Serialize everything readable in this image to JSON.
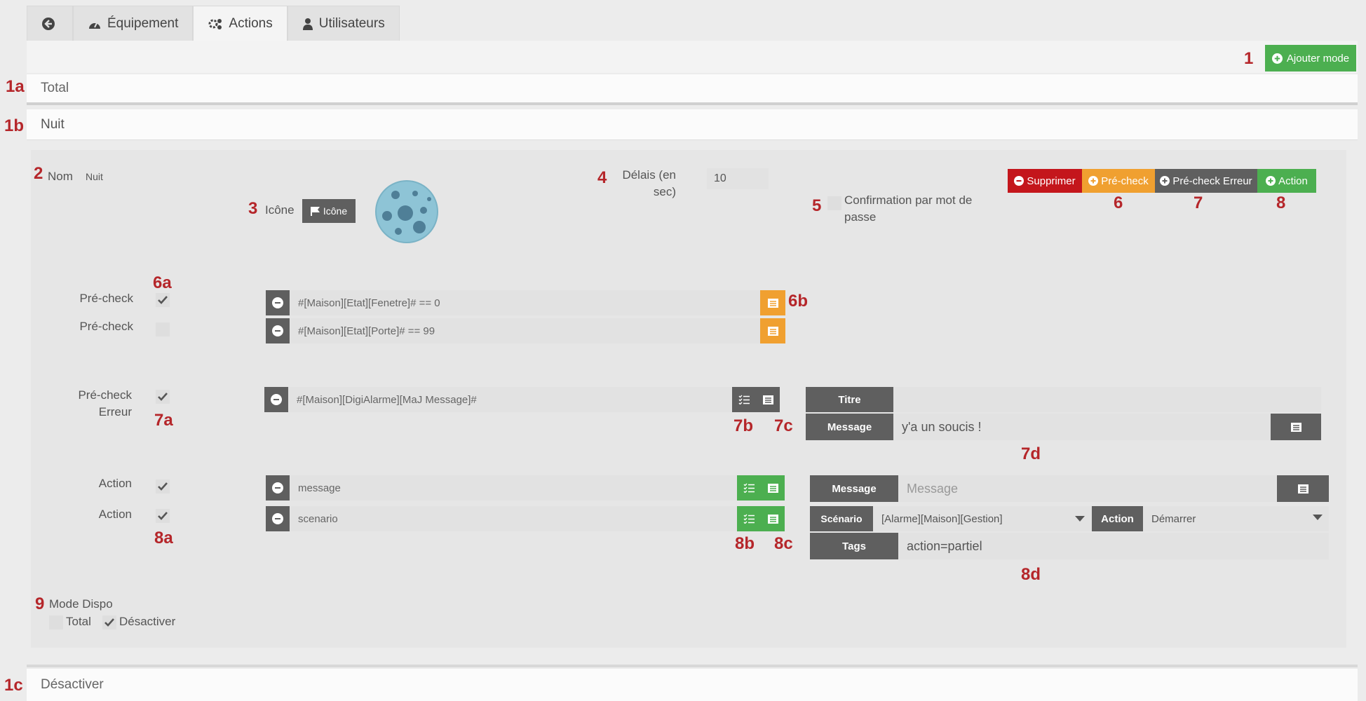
{
  "tabs": [
    {
      "label": "",
      "icon": "back-arrow-icon"
    },
    {
      "label": "Équipement",
      "icon": "dashboard-icon"
    },
    {
      "label": "Actions",
      "icon": "cogs-icon"
    },
    {
      "label": "Utilisateurs",
      "icon": "user-icon"
    }
  ],
  "toolbar": {
    "add_mode_label": "Ajouter mode"
  },
  "markers": {
    "m1": "1",
    "m1a": "1a",
    "m1b": "1b",
    "m1c": "1c",
    "m2": "2",
    "m3": "3",
    "m4": "4",
    "m5": "5",
    "m6": "6",
    "m7": "7",
    "m8": "8",
    "m6a": "6a",
    "m6b": "6b",
    "m7a": "7a",
    "m7b": "7b",
    "m7c": "7c",
    "m7d": "7d",
    "m8a": "8a",
    "m8b": "8b",
    "m8c": "8c",
    "m8d": "8d",
    "m9": "9"
  },
  "panels": {
    "total": "Total",
    "nuit": "Nuit",
    "desactiver": "Désactiver"
  },
  "mode": {
    "name_label": "Nom",
    "name_value": "Nuit",
    "icon_label": "Icône",
    "icon_button": "Icône",
    "delay_label_1": "Délais (en",
    "delay_label_2": "sec)",
    "delay_value": "10",
    "confirm_label_1": "Confirmation par mot de",
    "confirm_label_2": "passe",
    "buttons": {
      "delete": "Supprimer",
      "precheck": "Pré-check",
      "precheck_error": "Pré-check Erreur",
      "action": "Action"
    }
  },
  "prechecks": [
    {
      "label": "Pré-check",
      "checked": true,
      "expression": "#[Maison][Etat][Fenetre]# == 0"
    },
    {
      "label": "Pré-check",
      "checked": false,
      "expression": "#[Maison][Etat][Porte]# == 99"
    }
  ],
  "precheck_error": {
    "label_1": "Pré-check",
    "label_2": "Erreur",
    "command": "#[Maison][DigiAlarme][MaJ Message]#",
    "title_label": "Titre",
    "title_value": "",
    "message_label": "Message",
    "message_value": "y'a un soucis !"
  },
  "actions": [
    {
      "label": "Action",
      "command": "message",
      "opt_label": "Message",
      "opt_placeholder": "Message"
    },
    {
      "label": "Action",
      "command": "scenario",
      "scenario_label": "Scénario",
      "scenario_value": "[Alarme][Maison][Gestion]",
      "action_label": "Action",
      "action_value": "Démarrer",
      "tags_label": "Tags",
      "tags_value": "action=partiel"
    }
  ],
  "mode_dispo": {
    "label": "Mode Dispo",
    "options": [
      {
        "label": "Total",
        "checked": false
      },
      {
        "label": "Désactiver",
        "checked": true
      }
    ]
  },
  "colors": {
    "green": "#4caf50",
    "red": "#c4161c",
    "orange": "#f0a030",
    "dark": "#5f5f5f",
    "marker": "#b5262a"
  }
}
